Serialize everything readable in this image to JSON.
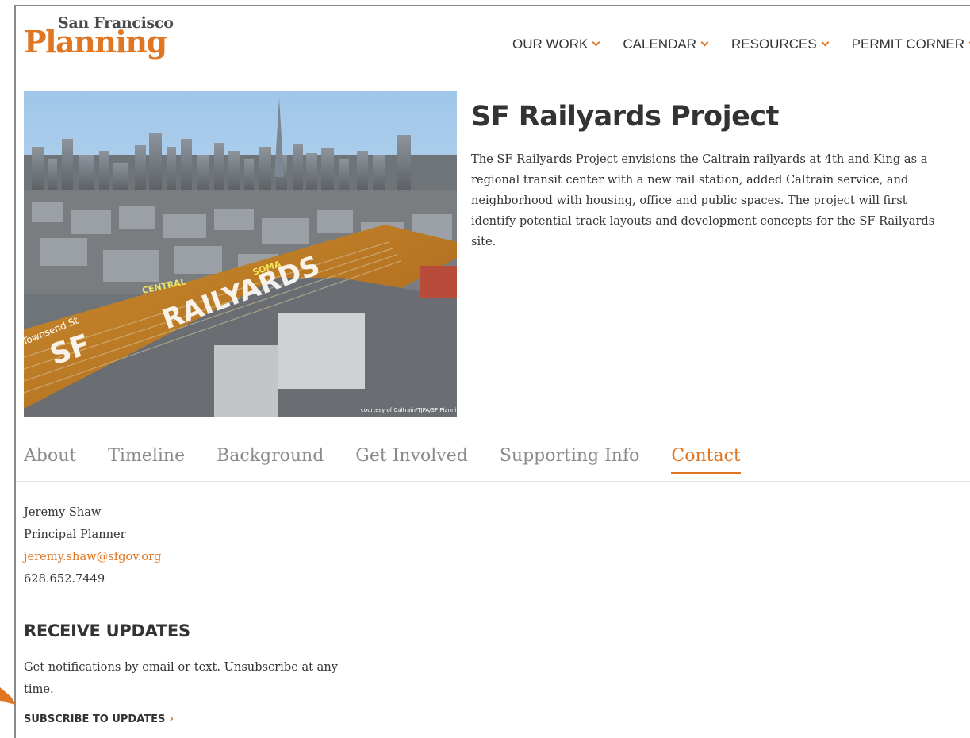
{
  "logo": {
    "top_text": "San Francisco",
    "main_text": "Planning"
  },
  "nav": {
    "items": [
      {
        "label": "OUR WORK"
      },
      {
        "label": "CALENDAR"
      },
      {
        "label": "RESOURCES"
      },
      {
        "label": "PERMIT CORNER"
      }
    ]
  },
  "hero": {
    "image_labels": [
      "SF",
      "RAILYARDS",
      "CENTRAL",
      "SOMA",
      "Townsend St"
    ],
    "credit": "courtesy of Caltrain/TJPA/SF Planning"
  },
  "project": {
    "title": "SF Railyards Project",
    "description": "The SF Railyards Project envisions the Caltrain railyards at 4th and King as a regional transit center with a new rail station, added Caltrain service, and neighborhood with housing, office and public spaces. The project will first identify potential track layouts and development concepts for the SF Railyards site."
  },
  "tabs": {
    "items": [
      {
        "label": "About"
      },
      {
        "label": "Timeline"
      },
      {
        "label": "Background"
      },
      {
        "label": "Get Involved"
      },
      {
        "label": "Supporting Info"
      },
      {
        "label": "Contact"
      }
    ],
    "active": "Contact"
  },
  "contact": {
    "name": "Jeremy Shaw",
    "role": "Principal Planner",
    "email": "jeremy.shaw@sfgov.org",
    "phone": "628.652.7449"
  },
  "updates": {
    "heading": "RECEIVE UPDATES",
    "text": "Get notifications by email or text. Unsubscribe at any time.",
    "subscribe_label": "SUBSCRIBE TO UPDATES",
    "subscribe_chevron": "›"
  },
  "colors": {
    "accent": "#e07622",
    "text": "#333333",
    "muted": "#8a8a8a"
  }
}
